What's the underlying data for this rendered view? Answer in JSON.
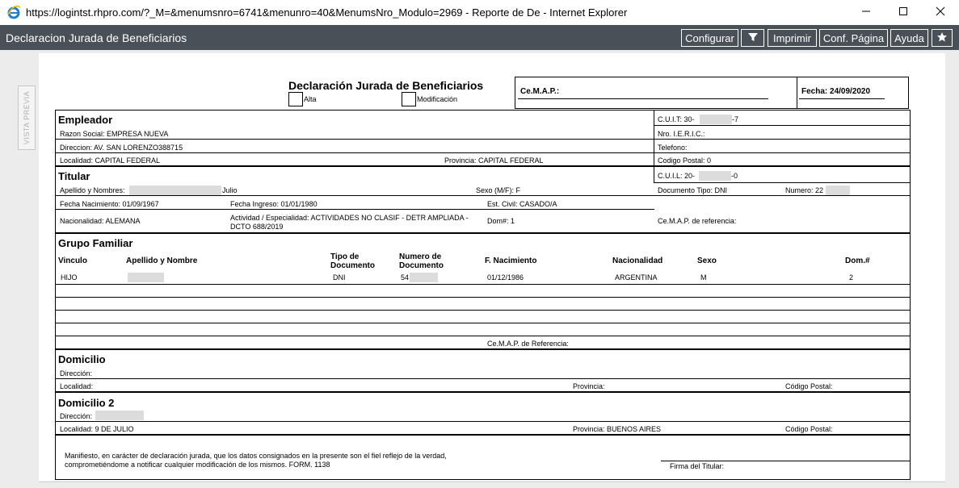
{
  "window": {
    "title": "https://logintst.rhpro.com/?_M=&menumsnro=6741&menunro=40&MenumsNro_Modulo=2969 - Reporte de De - Internet Explorer"
  },
  "toolbar": {
    "title": "Declaracion Jurada de Beneficiarios",
    "buttons": {
      "configurar": "Configurar",
      "imprimir": "Imprimir",
      "conf_pagina": "Conf. Página",
      "ayuda": "Ayuda"
    }
  },
  "side_tab": {
    "label": "VISTA PREVIA"
  },
  "report": {
    "title": "Declaración Jurada de Beneficiarios",
    "alta_label": "Alta",
    "modificacion_label": "Modificación",
    "cemap_label": "Ce.M.A.P.:",
    "fecha_label": "Fecha: 24/09/2020"
  },
  "empleador": {
    "heading": "Empleador",
    "cuit": "C.U.I.T:  30-",
    "cuit_suffix": "-7",
    "razon_social": "Razon Social: EMPRESA NUEVA",
    "ieric": "Nro. I.E.R.I.C.:",
    "direccion": "Direccion: AV. SAN LORENZO388715",
    "telefono": "Telefono:",
    "localidad": "Localidad: CAPITAL FEDERAL",
    "provincia": "Provincia: CAPITAL FEDERAL",
    "codigo_postal": "Codigo Postal: 0"
  },
  "titular": {
    "heading": "Titular",
    "cuil": "C.U.I.L:  20-",
    "cuil_suffix": "-0",
    "apellido_label": "Apellido y Nombres:",
    "apellido_suffix": "Julio",
    "sexo": "Sexo (M/F): F",
    "documento_tipo": "Documento Tipo: DNI",
    "numero": "Numero: 22",
    "fecha_nacimiento": "Fecha Nacimiento: 01/09/1967",
    "fecha_ingreso": "Fecha Ingreso: 01/01/1980",
    "estado_civil": "Est. Civil: CASADO/A",
    "nacionalidad": "Nacionalidad: ALEMANA",
    "actividad_line1": "Actividad / Especialidad: ACTIVIDADES NO CLASIF - DETR AMPLIADA -",
    "actividad_line2": "DCTO 688/2019",
    "dom_nro": "Dom#: 1",
    "cemap_ref": "Ce.M.A.P. de referencia:"
  },
  "grupo_familiar": {
    "heading": "Grupo Familiar",
    "columns": {
      "vinculo": "Vinculo",
      "apellido": "Apellido y Nombre",
      "tipo_doc_1": "Tipo de",
      "tipo_doc_2": "Documento",
      "numero_doc_1": "Numero de",
      "numero_doc_2": "Documento",
      "f_nacimiento": "F. Nacimiento",
      "nacionalidad": "Nacionalidad",
      "sexo": "Sexo",
      "dom": "Dom.#"
    },
    "rows": [
      {
        "vinculo": "HIJO",
        "tipo_doc": "DNI",
        "numero": "54",
        "f_nacimiento": "01/12/1986",
        "nacionalidad": "ARGENTINA",
        "sexo": "M",
        "dom": "2"
      }
    ],
    "cemap_ref": "Ce.M.A.P. de Referencia:"
  },
  "domicilio": {
    "heading": "Domicilio",
    "direccion": "Dirección:",
    "localidad": "Localidad:",
    "provincia": "Provincia:",
    "codigo_postal": "Código Postal:"
  },
  "domicilio2": {
    "heading": "Domicilio 2",
    "direccion": "Dirección:",
    "localidad": "Localidad: 9 DE JULIO",
    "provincia": "Provincia: BUENOS AIRES",
    "codigo_postal": "Código Postal:"
  },
  "footer": {
    "manifiesto_line1": "Manifiesto, en carácter de declaración jurada, que los datos consignados en la presente son el fiel reflejo de la verdad,",
    "manifiesto_line2": "comprometiéndome a notificar cualquier modificación de los mismos. FORM. 1138",
    "firma": "Firma del Titular:"
  }
}
